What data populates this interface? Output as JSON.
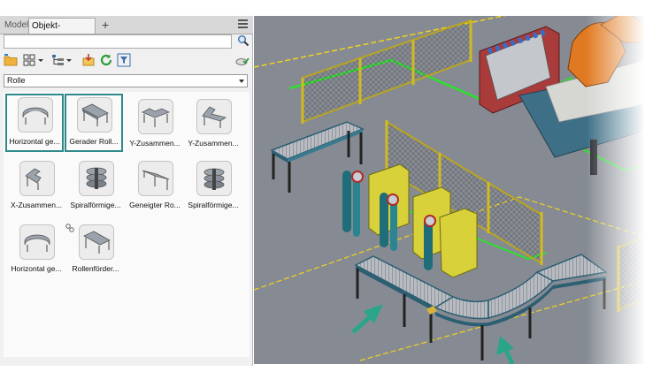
{
  "tabs": [
    {
      "label": "Modell"
    },
    {
      "label": "Objekt-Browser"
    }
  ],
  "tab_add_label": "+",
  "search": {
    "value": "",
    "placeholder": ""
  },
  "filter": {
    "selected": "Rolle"
  },
  "items": [
    {
      "label": "Horizontal ge..."
    },
    {
      "label": "Gerader Roll..."
    },
    {
      "label": "Y-Zusammen..."
    },
    {
      "label": "Y-Zusammen..."
    },
    {
      "label": "X-Zusammen..."
    },
    {
      "label": "Spiralförmige..."
    },
    {
      "label": "Geneigter Ro..."
    },
    {
      "label": "Spiralförmige..."
    },
    {
      "label": "Horizontal ge..."
    },
    {
      "label": "Rollenförder..."
    }
  ],
  "colors": {
    "selection": "#2f8a8a",
    "arrow": "#2aa58a",
    "floor_line": "#f2d21b",
    "fence": "#b9a521"
  }
}
